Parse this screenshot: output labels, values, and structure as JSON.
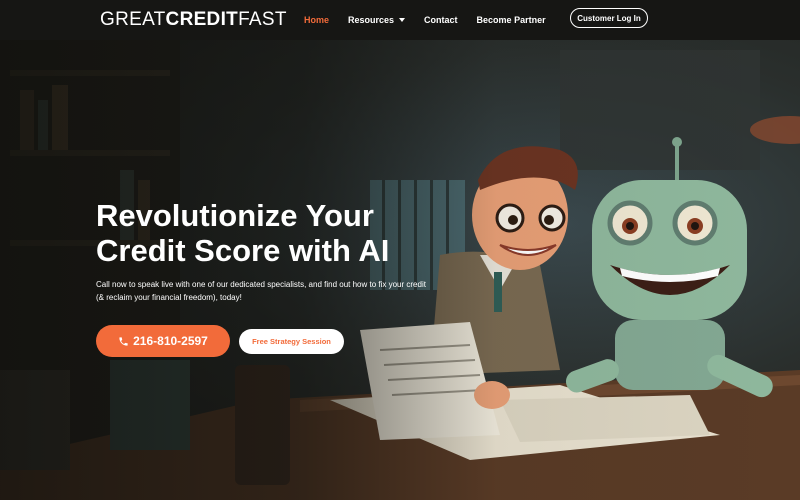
{
  "brand": {
    "logo_thin_1": "GREAT",
    "logo_bold": "CREDIT",
    "logo_thin_2": "FAST"
  },
  "nav": {
    "items": [
      {
        "label": "Home",
        "active": true
      },
      {
        "label": "Resources",
        "has_dropdown": true
      },
      {
        "label": "Contact"
      },
      {
        "label": "Become Partner"
      }
    ],
    "login_label": "Customer Log In"
  },
  "hero": {
    "headline": "Revolutionize Your Credit Score with AI",
    "subtext": "Call now to speak live with one of our dedicated specialists, and find out how to fix your credit (& reclaim your financial freedom), today!",
    "phone_label": "216-810-2597",
    "phone_icon": "phone-icon",
    "session_label": "Free Strategy Session"
  },
  "colors": {
    "accent": "#f26b3a",
    "nav_bg": "#161614",
    "text": "#ffffff"
  }
}
